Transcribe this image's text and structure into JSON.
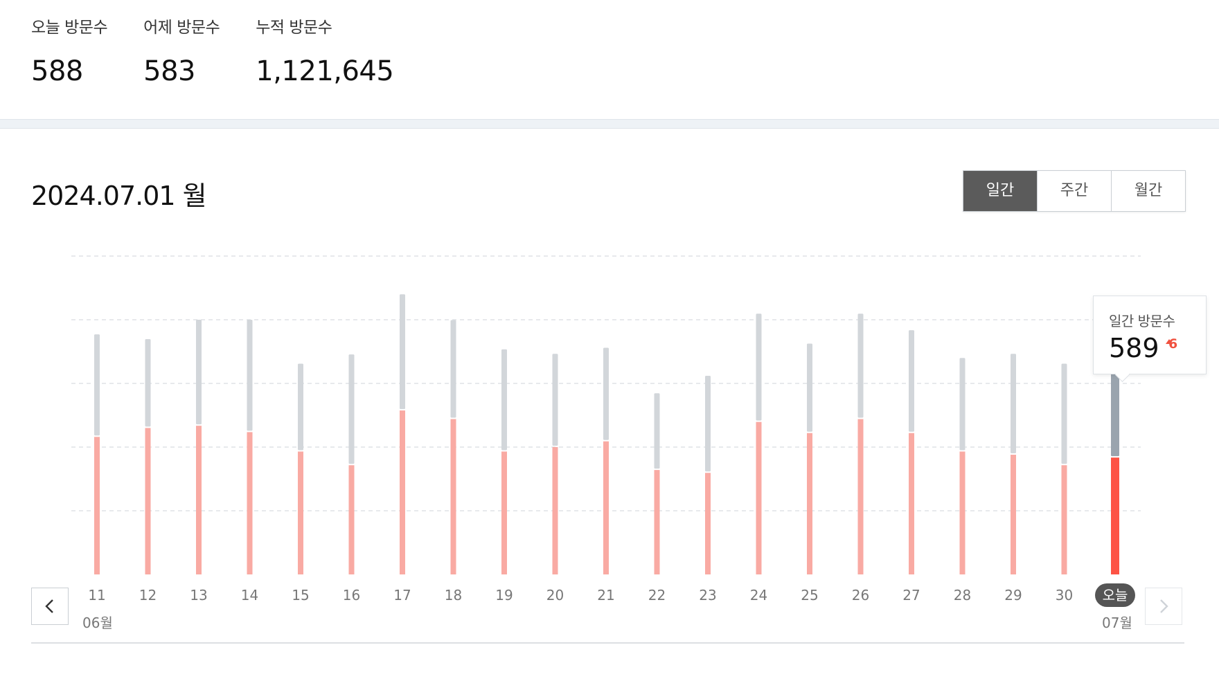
{
  "stats": [
    {
      "label": "오늘 방문수",
      "value": "588"
    },
    {
      "label": "어제 방문수",
      "value": "583"
    },
    {
      "label": "누적 방문수",
      "value": "1,121,645"
    }
  ],
  "date_title": "2024.07.01 월",
  "period_tabs": [
    {
      "label": "일간",
      "active": true
    },
    {
      "label": "주간",
      "active": false
    },
    {
      "label": "월간",
      "active": false
    }
  ],
  "nav": {
    "prev_icon": "chevron-left-icon",
    "next_icon": "chevron-right-icon"
  },
  "months": {
    "start": "06월",
    "end": "07월"
  },
  "tooltip": {
    "label": "일간 방문수",
    "value": "589",
    "change": "6",
    "change_icon": "triangle-up-icon"
  },
  "colors": {
    "page_views": "#f9aaa3",
    "visitors": "#d2d6da",
    "today_page_views": "#fd5345",
    "today_visitors": "#9aa4ae",
    "today_badge": "#555555"
  },
  "chart_data": {
    "type": "bar",
    "categories": [
      "11",
      "12",
      "13",
      "14",
      "15",
      "16",
      "17",
      "18",
      "19",
      "20",
      "21",
      "22",
      "23",
      "24",
      "25",
      "26",
      "27",
      "28",
      "29",
      "30",
      "오늘"
    ],
    "series": [
      {
        "values": [
          432,
          460,
          467,
          447,
          386,
          343,
          515,
          488,
          386,
          400,
          418,
          328,
          319,
          479,
          444,
          488,
          444,
          386,
          376,
          343,
          367
        ]
      },
      {
        "values": [
          754,
          739,
          800,
          800,
          662,
          691,
          880,
          799,
          707,
          693,
          712,
          569,
          624,
          819,
          725,
          819,
          767,
          680,
          693,
          662,
          670
        ]
      }
    ],
    "stacked": true,
    "grid": true,
    "gridlines": 5,
    "highlighted_index": 20
  }
}
